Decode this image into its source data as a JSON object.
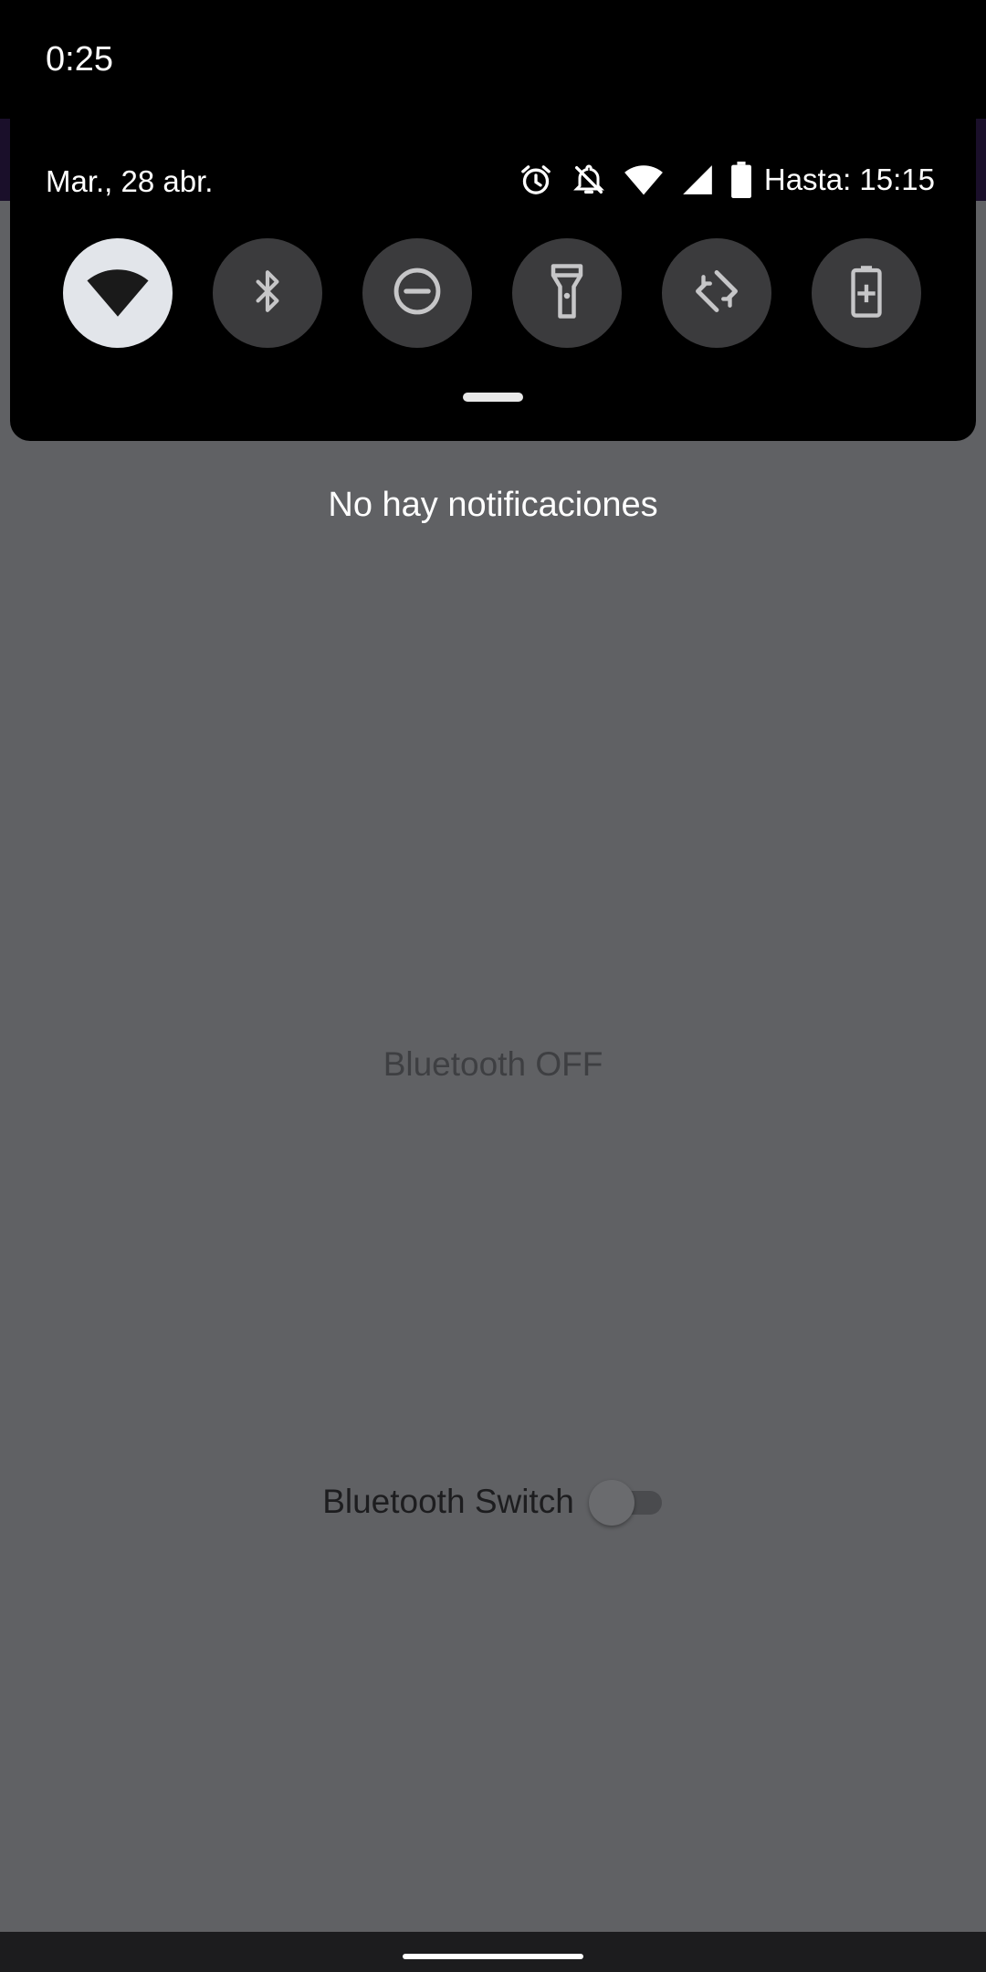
{
  "status_bar": {
    "time": "0:25"
  },
  "quick_settings": {
    "date": "Mar., 28 abr.",
    "status_icons": [
      "alarm-icon",
      "notifications-off-icon",
      "wifi-icon",
      "cell-signal-icon",
      "battery-icon"
    ],
    "battery_text": "Hasta: 15:15",
    "tiles": [
      {
        "name": "wifi",
        "icon": "wifi-icon",
        "active": true
      },
      {
        "name": "bluetooth",
        "icon": "bluetooth-icon",
        "active": false
      },
      {
        "name": "do-not-disturb",
        "icon": "do-not-disturb-icon",
        "active": false
      },
      {
        "name": "flashlight",
        "icon": "flashlight-icon",
        "active": false
      },
      {
        "name": "auto-rotate",
        "icon": "auto-rotate-icon",
        "active": false
      },
      {
        "name": "battery-saver",
        "icon": "battery-saver-icon",
        "active": false
      }
    ]
  },
  "notifications": {
    "empty_text": "No hay notificaciones"
  },
  "app": {
    "bluetooth_status": "Bluetooth OFF",
    "switch_label": "Bluetooth Switch",
    "switch_on": false
  },
  "colors": {
    "shade_background": "#000000",
    "scrim": "#606164",
    "tile_active": "#e2e5ea",
    "tile_inactive": "#3b3b3d"
  }
}
